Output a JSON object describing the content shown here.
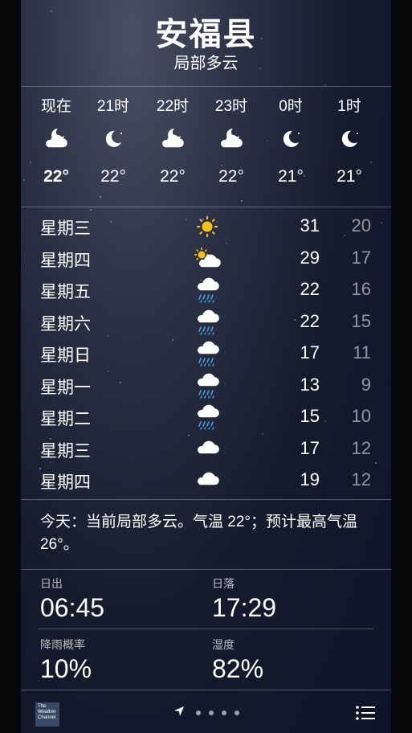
{
  "location": {
    "city": "安福县",
    "condition": "局部多云"
  },
  "hourly": [
    {
      "time": "现在",
      "icon": "partly-cloudy-night-icon",
      "temp": "22°"
    },
    {
      "time": "21时",
      "icon": "moon-icon",
      "temp": "22°"
    },
    {
      "time": "22时",
      "icon": "partly-cloudy-night-icon",
      "temp": "22°"
    },
    {
      "time": "23时",
      "icon": "partly-cloudy-night-icon",
      "temp": "22°"
    },
    {
      "time": "0时",
      "icon": "moon-icon",
      "temp": "21°"
    },
    {
      "time": "1时",
      "icon": "moon-icon",
      "temp": "21°"
    }
  ],
  "daily": [
    {
      "day": "星期三",
      "icon": "sun-icon",
      "high": "31",
      "low": "20"
    },
    {
      "day": "星期四",
      "icon": "partly-sunny-icon",
      "high": "29",
      "low": "17"
    },
    {
      "day": "星期五",
      "icon": "rain-icon",
      "high": "22",
      "low": "16"
    },
    {
      "day": "星期六",
      "icon": "rain-icon",
      "high": "22",
      "low": "15"
    },
    {
      "day": "星期日",
      "icon": "rain-icon",
      "high": "17",
      "low": "11"
    },
    {
      "day": "星期一",
      "icon": "rain-icon",
      "high": "13",
      "low": "9"
    },
    {
      "day": "星期二",
      "icon": "rain-icon",
      "high": "15",
      "low": "10"
    },
    {
      "day": "星期三",
      "icon": "cloud-icon",
      "high": "17",
      "low": "12"
    },
    {
      "day": "星期四",
      "icon": "cloud-icon",
      "high": "19",
      "low": "12"
    }
  ],
  "summary": "今天：当前局部多云。气温 22°；预计最高气温 26°。",
  "details": {
    "sunrise": {
      "label": "日出",
      "value": "06:45"
    },
    "sunset": {
      "label": "日落",
      "value": "17:29"
    },
    "rain": {
      "label": "降雨概率",
      "value": "10%"
    },
    "humidity": {
      "label": "湿度",
      "value": "82%"
    }
  },
  "footer": {
    "logo_text": "The Weather Channel"
  },
  "colors": {
    "sun": "#f4c01e",
    "rain": "#4aa3e8",
    "background": "#151a2c"
  }
}
